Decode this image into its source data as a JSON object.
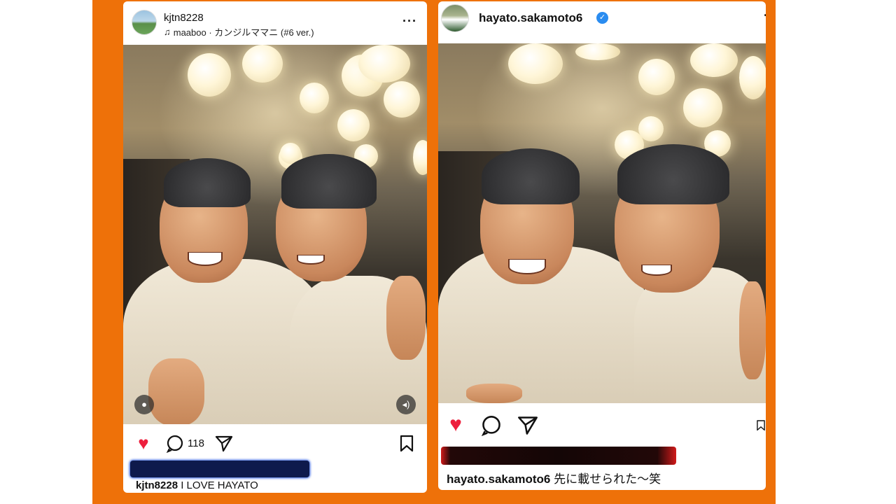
{
  "colors": {
    "frame_orange": "#ee7109",
    "like_red": "#ed1e3c",
    "verified_blue": "#2a8cf0"
  },
  "left_post": {
    "username": "kjtn8228",
    "music_icon": "music-note-icon",
    "music": "maaboo · カンジルママニ (#6 ver.)",
    "more": "···",
    "comment_count": "118",
    "caption_user": "kjtn8228",
    "caption_text": "I LOVE HAYATO"
  },
  "right_post": {
    "username": "hayato.sakamoto6",
    "verified": "✓",
    "more": "·",
    "caption_user": "hayato.sakamoto6",
    "caption_text": "先に載せられた〜笑"
  }
}
